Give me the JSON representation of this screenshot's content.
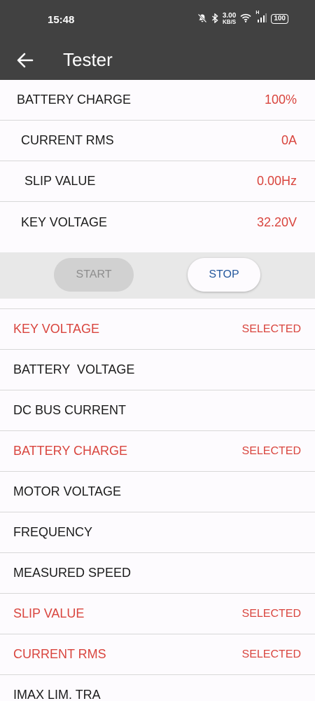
{
  "status_bar": {
    "time": "15:48",
    "net_speed_value": "3.00",
    "net_speed_unit": "KB/S",
    "signal_label": "H",
    "battery": "100"
  },
  "app_bar": {
    "title": "Tester"
  },
  "readings": [
    {
      "label": "BATTERY CHARGE",
      "value": "100%"
    },
    {
      "label": "CURRENT RMS",
      "value": "0A"
    },
    {
      "label": "SLIP VALUE",
      "value": "0.00Hz"
    },
    {
      "label": "KEY VOLTAGE",
      "value": "32.20V"
    }
  ],
  "controls": {
    "start_label": "START",
    "stop_label": "STOP"
  },
  "parameters": [
    {
      "label": "KEY VOLTAGE",
      "status": "SELECTED"
    },
    {
      "label": "BATTERY  VOLTAGE",
      "status": ""
    },
    {
      "label": "DC BUS CURRENT",
      "status": ""
    },
    {
      "label": "BATTERY CHARGE",
      "status": "SELECTED"
    },
    {
      "label": "MOTOR VOLTAGE",
      "status": ""
    },
    {
      "label": "FREQUENCY",
      "status": ""
    },
    {
      "label": "MEASURED SPEED",
      "status": ""
    },
    {
      "label": "SLIP VALUE",
      "status": "SELECTED"
    },
    {
      "label": "CURRENT RMS",
      "status": "SELECTED"
    },
    {
      "label": "IMAX LIM. TRA",
      "status": ""
    }
  ],
  "colors": {
    "bar_background": "#414141",
    "selected_text": "#d9453e",
    "stop_text": "#23579d"
  }
}
